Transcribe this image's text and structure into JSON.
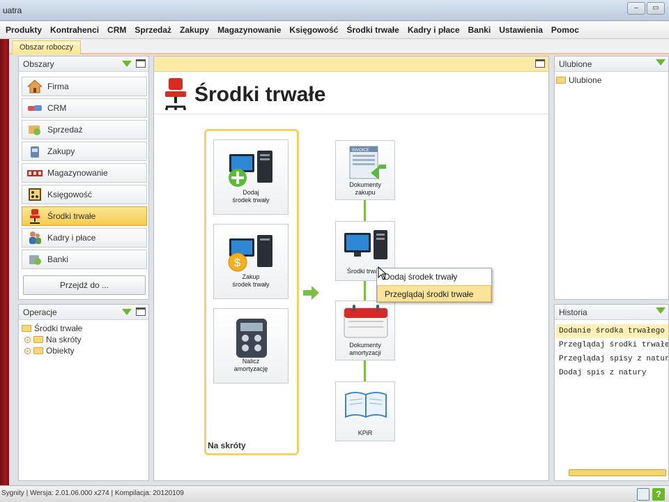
{
  "window": {
    "title": "uatra",
    "btn_min": "–",
    "btn_max": "▭",
    "btn_close": "✕"
  },
  "menu": [
    "Produkty",
    "Kontrahenci",
    "CRM",
    "Sprzedaż",
    "Zakupy",
    "Magazynowanie",
    "Księgowość",
    "Środki trwałe",
    "Kadry i płace",
    "Banki",
    "Ustawienia",
    "Pomoc"
  ],
  "tab": {
    "label": "Obszar roboczy"
  },
  "areas": {
    "title": "Obszary",
    "items": [
      {
        "label": "Firma",
        "icon": "house-icon"
      },
      {
        "label": "CRM",
        "icon": "handshake-icon"
      },
      {
        "label": "Sprzedaż",
        "icon": "sale-icon"
      },
      {
        "label": "Zakupy",
        "icon": "shopping-icon"
      },
      {
        "label": "Magazynowanie",
        "icon": "warehouse-icon"
      },
      {
        "label": "Księgowość",
        "icon": "abacus-icon"
      },
      {
        "label": "Środki trwałe",
        "icon": "office-chair-icon"
      },
      {
        "label": "Kadry i płace",
        "icon": "people-icon"
      },
      {
        "label": "Banki",
        "icon": "bank-icon"
      }
    ],
    "goto_label": "Przejdź do ..."
  },
  "operations": {
    "title": "Operacje",
    "root": "Środki trwałe",
    "children": [
      "Na skróty",
      "Obiekty"
    ]
  },
  "main": {
    "title": "Środki trwałe",
    "shortcuts_label": "Na skróty",
    "shortcuts": [
      "Dodaj\nśrodek trwały",
      "Zakup\nśrodek trwały",
      "Nalicz\namortyzację"
    ],
    "flow": [
      "Dokumenty\nzakupu",
      "Środki trwałe",
      "Dokumenty\namortyzacji",
      "KPiR"
    ],
    "invoice_label": "INVOICE"
  },
  "context_menu": {
    "items": [
      "Dodaj środek trwały",
      "Przeglądaj środki trwałe"
    ],
    "highlighted": 1
  },
  "favorites": {
    "title": "Ulubione",
    "folder": "Ulubione"
  },
  "history": {
    "title": "Historia",
    "items": [
      "Dodanie środka trwałego",
      "Przeglądaj środki trwałe",
      "Przeglądaj spisy z natury",
      "Dodaj spis z natury"
    ]
  },
  "status": {
    "text": "Sygnity | Wersja: 2.01.06.000 x274 | Kompilacja: 20120109",
    "help": "?"
  },
  "colors": {
    "accent": "#f4cc4c",
    "brand_red": "#a8161c",
    "flow_green": "#7bc043"
  }
}
